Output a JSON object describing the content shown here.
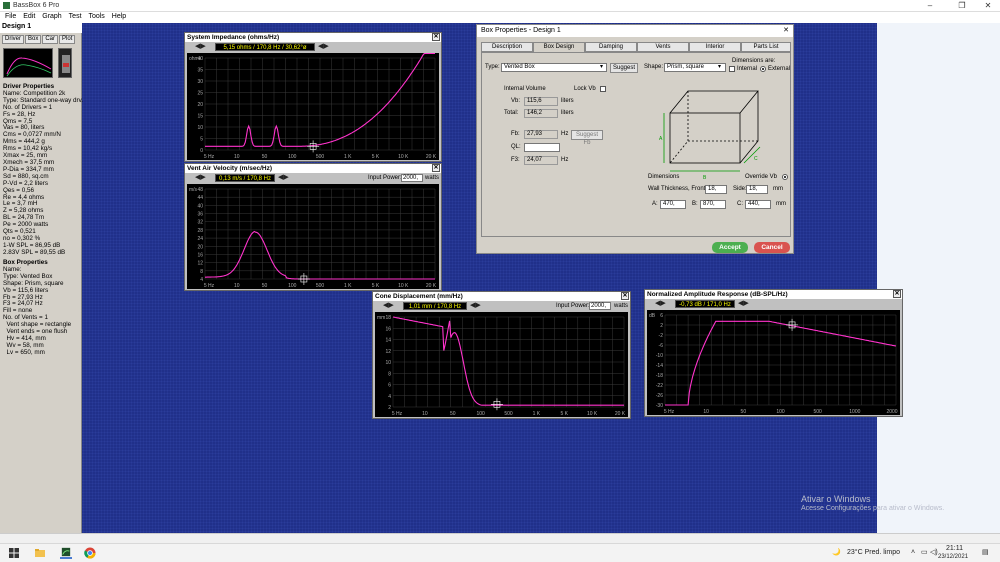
{
  "app": {
    "title": "BassBox 6 Pro",
    "min": "–",
    "max": "❐",
    "close": "✕"
  },
  "menu": [
    "File",
    "Edit",
    "Graph",
    "Test",
    "Tools",
    "Help"
  ],
  "left": {
    "design_title": "Design 1",
    "tabs": [
      "Driver",
      "Box",
      "Car",
      "Plot"
    ],
    "driver_heading": "Driver Properties",
    "driver_lines": [
      "Name: Competition 2k",
      "Type: Standard one-way drv.",
      "No. of Drivers = 1",
      "Fs = 28, Hz",
      "Qms = 7,5",
      "Vas = 80, liters",
      "Cms = 0,0727 mm/N",
      "Mms = 444,2 g",
      "Rms = 10,42 kg/s",
      "Xmax = 25, mm",
      "Xmech = 37,5 mm",
      "P-Dia = 334,7 mm",
      "Sd = 880, sq.cm",
      "P-Vd = 2,2 liters",
      "Qes = 0,56",
      "Re = 4,4 ohms",
      "Le = 3,7 mH",
      "Z = 5,28 ohms",
      "BL = 24,78 Tm",
      "Pe = 2000 watts",
      "Qts = 0,521",
      "no = 0,302 %",
      "1-W SPL = 86,95 dB",
      "2.83V SPL = 89,55 dB"
    ],
    "box_heading": "Box Properties",
    "box_lines": [
      "Name:",
      "Type: Vented Box",
      "Shape: Prism, square",
      "Vb = 115,6 liters",
      "Fb = 27,93 Hz",
      "F3 = 24,07 Hz",
      "Fill = none",
      "No. of Vents = 1",
      "  Vent shape = rectangle",
      "  Vent ends = one flush",
      "  Hv = 414, mm",
      "  Wv = 58, mm",
      "  Lv = 650, mm"
    ]
  },
  "windows": {
    "impedance": {
      "title": "System Impedance (ohms/Hz)",
      "readout": "5,15 ohms / 170,8 Hz / 30,62°ø",
      "yunit": "ohms",
      "yticks": [
        "40",
        "35",
        "30",
        "25",
        "20",
        "15",
        "10",
        "5",
        "0"
      ],
      "xticks": [
        "5 Hz",
        "10",
        "50",
        "100",
        "500",
        "1 K",
        "5 K",
        "10 K",
        "20 K"
      ]
    },
    "velocity": {
      "title": "Vent Air Velocity (m/sec/Hz)",
      "readout": "0,13 m/s / 170,8 Hz",
      "input_power_label": "Input Power:",
      "input_power": "2000,",
      "watts": "watts",
      "yunit": "m/s",
      "yticks": [
        "48",
        "44",
        "40",
        "36",
        "32",
        "28",
        "24",
        "20",
        "16",
        "12",
        "8",
        "4"
      ],
      "xticks": [
        "5 Hz",
        "10",
        "50",
        "100",
        "500",
        "1 K",
        "5 K",
        "10 K",
        "20 K"
      ]
    },
    "cone": {
      "title": "Cone Displacement (mm/Hz)",
      "readout": "1,01 mm / 170,8 Hz",
      "input_power_label": "Input Power:",
      "input_power": "2000,",
      "watts": "watts",
      "yunit": "mm",
      "yticks": [
        "18",
        "16",
        "14",
        "12",
        "10",
        "8",
        "6",
        "4",
        "2"
      ],
      "xticks": [
        "5 Hz",
        "10",
        "50",
        "100",
        "500",
        "1 K",
        "5 K",
        "10 K",
        "20 K"
      ]
    },
    "response": {
      "title": "Normalized Amplitude Response (dB-SPL/Hz)",
      "readout": "-0,73 dB / 171,0 Hz",
      "yunit": "dB",
      "yticks": [
        "6",
        "2",
        "-2",
        "-6",
        "-10",
        "-14",
        "-18",
        "-22",
        "-26",
        "-30"
      ],
      "xticks": [
        "5 Hz",
        "10",
        "50",
        "100",
        "500",
        "1000",
        "2000"
      ]
    }
  },
  "dialog": {
    "title": "Box Properties - Design 1",
    "tabs": [
      "Description",
      "Box Design",
      "Damping",
      "Vents",
      "Interior",
      "Parts List"
    ],
    "type_label": "Type:",
    "type_value": "Vented Box",
    "suggest": "Suggest",
    "shape_label": "Shape:",
    "shape_value": "Prism, square",
    "dims_are": "Dimensions are:",
    "internal": "Internal",
    "external": "External",
    "internal_volume": "Internal Volume",
    "lock_vb": "Lock Vb",
    "vb_label": "Vb:",
    "vb_value": "115,6",
    "vb_unit": "liters",
    "total_label": "Total:",
    "total_value": "146,2",
    "total_unit": "liters",
    "fb_label": "Fb:",
    "fb_value": "27,93",
    "fb_unit": "Hz",
    "suggest_fb": "Suggest Fb",
    "ql_label": "QL:",
    "ql_value": "",
    "f3_label": "F3:",
    "f3_value": "24,07",
    "f3_unit": "Hz",
    "dimensions": "Dimensions",
    "override_vb": "Override Vb",
    "wall_label": "Wall Thickness, Front:",
    "wall_front": "18,",
    "side_label": "Side:",
    "wall_side": "18,",
    "mm": "mm",
    "a_label": "A:",
    "a_value": "470,",
    "b_label": "B:",
    "b_value": "870,",
    "c_label": "C:",
    "c_value": "440,",
    "accept": "Accept",
    "cancel": "Cancel",
    "box_labels": {
      "a": "A",
      "b": "B",
      "c": "C"
    }
  },
  "watermark": {
    "line1": "Ativar o Windows",
    "line2": "Acesse Configurações para ativar o Windows."
  },
  "taskbar": {
    "weather": "23°C  Pred. limpo",
    "time": "21:11",
    "date": "23/12/2021"
  },
  "colors": {
    "desktop": "#20308a",
    "curve": "#ff33cc",
    "accept": "#4caf50",
    "cancel": "#d9534f"
  }
}
